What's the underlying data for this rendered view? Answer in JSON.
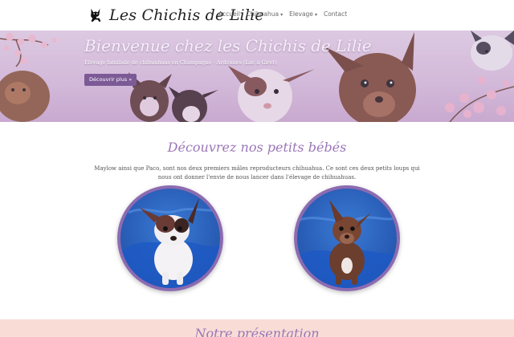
{
  "brand": {
    "name": "Les Chichis de Lilie",
    "logo_icon": "chihuahua-silhouette-icon"
  },
  "nav": {
    "items": [
      {
        "label": "Accueil",
        "dropdown": false
      },
      {
        "label": "Chihuahua",
        "dropdown": true
      },
      {
        "label": "Elevage",
        "dropdown": true
      },
      {
        "label": "Contact",
        "dropdown": false
      }
    ],
    "caret": "▾"
  },
  "hero": {
    "title": "Bienvenue chez les Chichis de Lilie",
    "subtitle": "Elevage familiale de chihuahuas en Champagne - Ardennes (Lac à Giret)",
    "button_label": "Découvrir plus »"
  },
  "intro": {
    "title": "Découvrez nos petits bébés",
    "text": "Maylow ainsi que Paco, sont nos deux premiers mâles reproducteurs chihuahua. Ce sont ces deux petits loups qui nous ont donner l'envie de nous lancer dans l'élevage de chihuahuas."
  },
  "photos": [
    {
      "icon": "puppy-white-brown-photo"
    },
    {
      "icon": "puppy-chocolate-photo"
    }
  ],
  "next_section": {
    "title": "Notre présentation"
  },
  "colors": {
    "accent": "#9a76b8",
    "button": "#7b5a96",
    "photo_border": "#8c6bb1",
    "bottom_band": "#f9dcd6"
  }
}
